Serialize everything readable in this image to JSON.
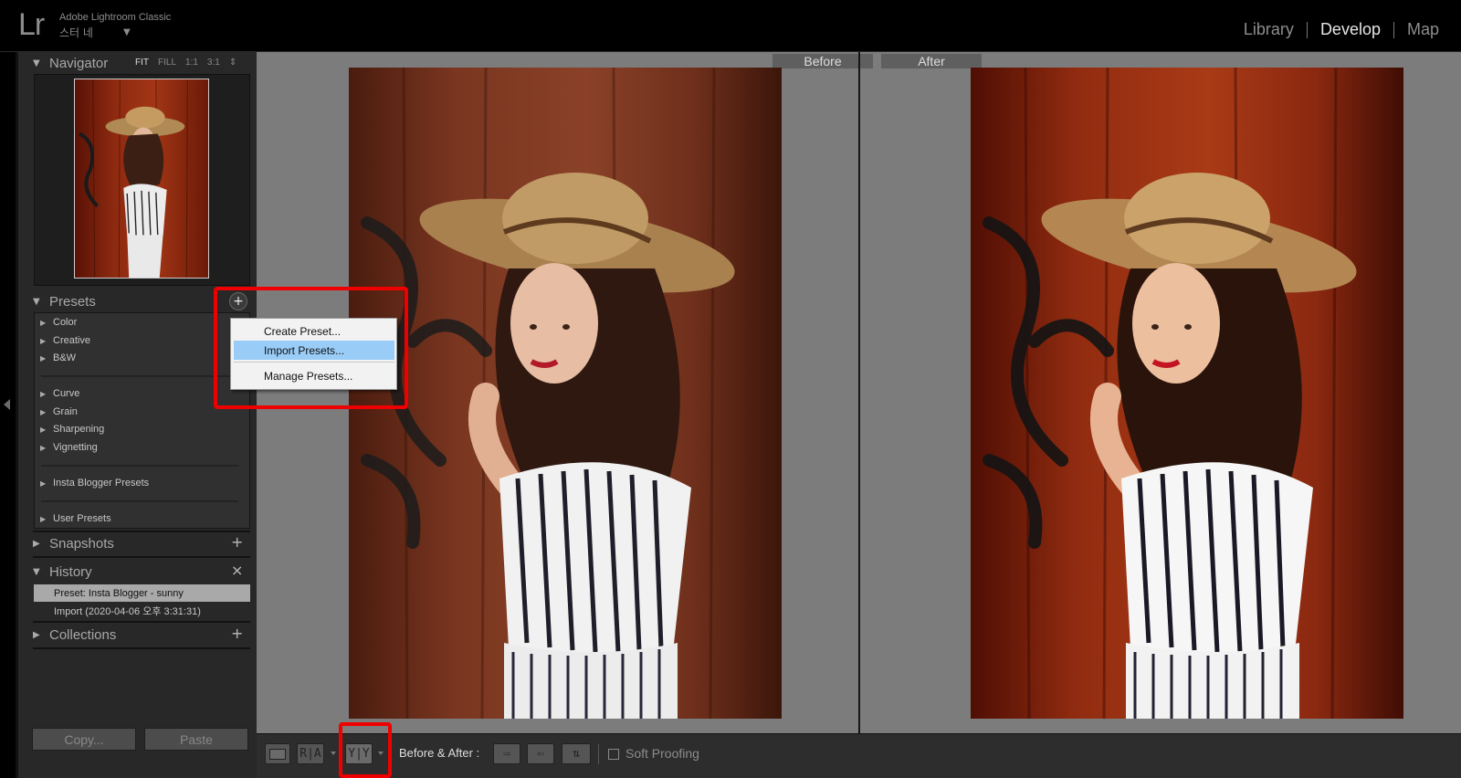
{
  "app": {
    "logo": "Lr",
    "title": "Adobe Lightroom Classic",
    "identity": "스터 네",
    "identity_arrow": "▼"
  },
  "modules": [
    {
      "label": "Library",
      "active": false
    },
    {
      "label": "Develop",
      "active": true
    },
    {
      "label": "Map",
      "active": false
    }
  ],
  "navigator": {
    "title": "Navigator",
    "zoom": [
      "FIT",
      "FILL",
      "1:1",
      "3:1"
    ],
    "zoom_selected": "FIT",
    "zoom_arrows": "⇕"
  },
  "presets": {
    "title": "Presets",
    "add_symbol": "+",
    "groups": [
      {
        "items": [
          "Color",
          "Creative",
          "B&W"
        ]
      },
      {
        "items": [
          "Curve",
          "Grain",
          "Sharpening",
          "Vignetting"
        ]
      },
      {
        "items": [
          "Insta Blogger Presets"
        ]
      },
      {
        "items": [
          "User Presets"
        ]
      }
    ]
  },
  "preset_menu": {
    "items": [
      "Create Preset...",
      "Import Presets...",
      "Manage Presets..."
    ],
    "highlighted": "Import Presets..."
  },
  "snapshots": {
    "title": "Snapshots",
    "action": "+"
  },
  "history": {
    "title": "History",
    "action": "×",
    "items": [
      {
        "label": "Preset: Insta Blogger - sunny",
        "selected": true
      },
      {
        "label": "Import (2020-04-06 오후 3:31:31)",
        "selected": false
      }
    ]
  },
  "collections": {
    "title": "Collections",
    "action": "+"
  },
  "buttons": {
    "copy": "Copy...",
    "paste": "Paste"
  },
  "views": {
    "before": "Before",
    "after": "After"
  },
  "toolbar": {
    "loupe_icon": "loupe-view-icon",
    "ra_label": "R|A",
    "yy_label": "Y|Y",
    "before_after_label": "Before & After :",
    "soft_proofing_label": "Soft Proofing",
    "soft_proofing_checked": false
  },
  "colors": {
    "highlight": "#ee0000",
    "menu_hover": "#99ccf7",
    "history_selected": "#a9a9a9"
  }
}
